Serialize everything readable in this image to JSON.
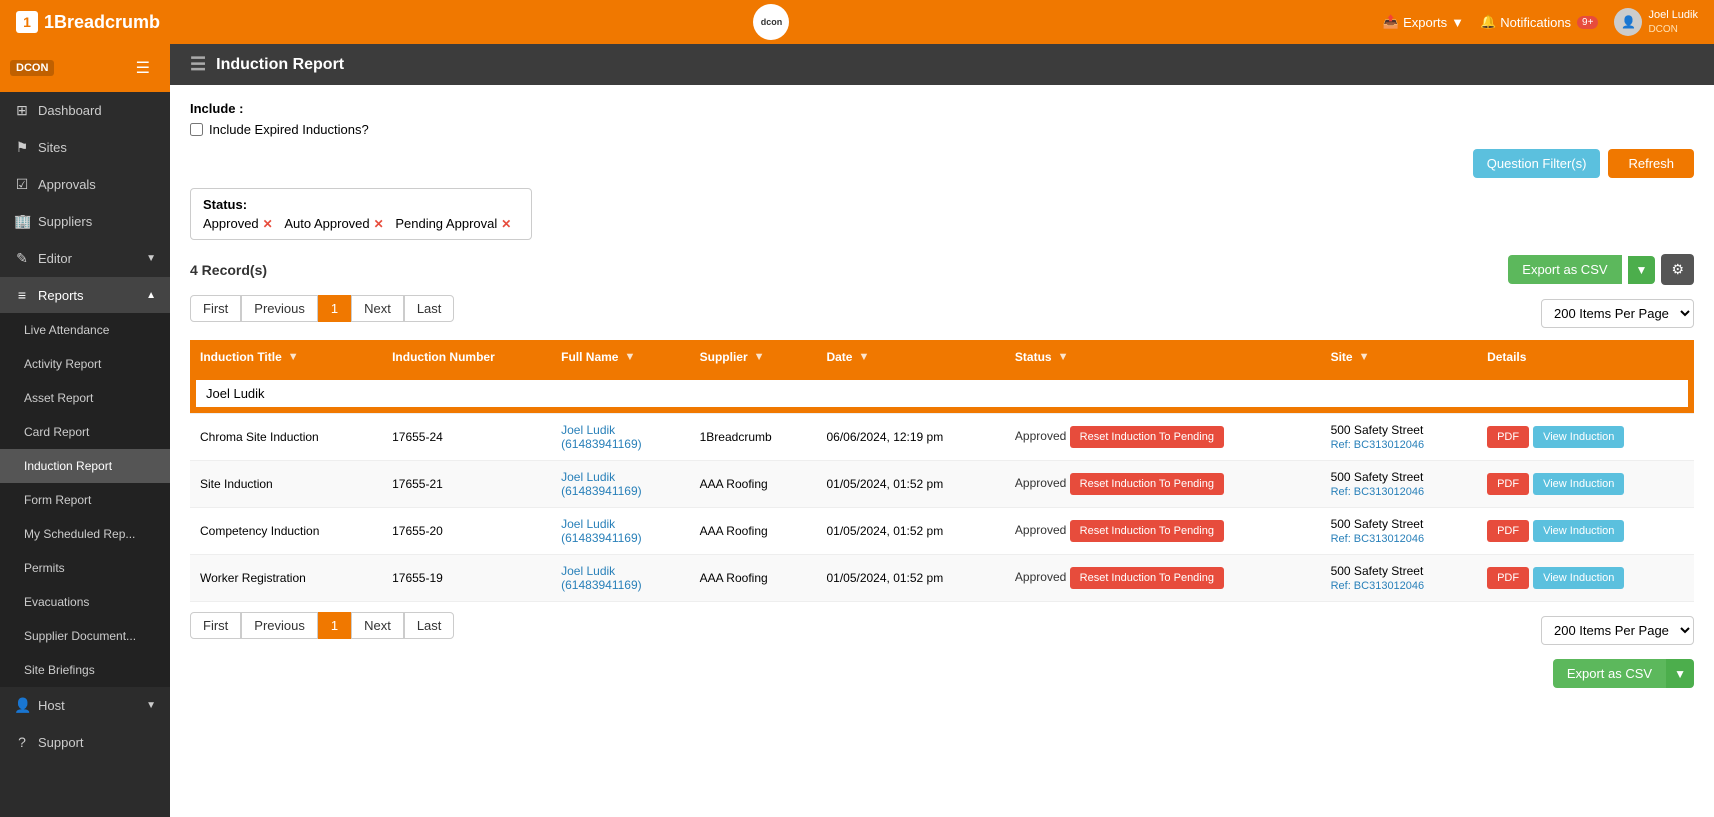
{
  "topNav": {
    "brandName": "1Breadcrumb",
    "logoText": "dcon",
    "exports": "Exports",
    "notifications": "Notifications",
    "notifCount": "9+",
    "userName": "Joel Ludik",
    "userTenant": "DCON"
  },
  "sidebar": {
    "tenant": "DCON",
    "items": [
      {
        "label": "Dashboard",
        "icon": "⊞",
        "id": "dashboard"
      },
      {
        "label": "Sites",
        "icon": "⚑",
        "id": "sites"
      },
      {
        "label": "Approvals",
        "icon": "☑",
        "id": "approvals"
      },
      {
        "label": "Suppliers",
        "icon": "🏢",
        "id": "suppliers"
      },
      {
        "label": "Editor",
        "icon": "✎",
        "id": "editor",
        "hasArrow": true
      },
      {
        "label": "Reports",
        "icon": "≡",
        "id": "reports",
        "expanded": true,
        "hasArrow": true
      },
      {
        "label": "Live Attendance",
        "id": "live-attendance",
        "sub": true
      },
      {
        "label": "Activity Report",
        "id": "activity-report",
        "sub": true
      },
      {
        "label": "Asset Report",
        "id": "asset-report",
        "sub": true
      },
      {
        "label": "Card Report",
        "id": "card-report",
        "sub": true
      },
      {
        "label": "Induction Report",
        "id": "induction-report",
        "sub": true,
        "active": true
      },
      {
        "label": "Form Report",
        "id": "form-report",
        "sub": true
      },
      {
        "label": "My Scheduled Rep...",
        "id": "my-scheduled-rep",
        "sub": true
      },
      {
        "label": "Permits",
        "id": "permits",
        "sub": true
      },
      {
        "label": "Evacuations",
        "id": "evacuations",
        "sub": true
      },
      {
        "label": "Supplier Document...",
        "id": "supplier-documents",
        "sub": true
      },
      {
        "label": "Site Briefings",
        "id": "site-briefings",
        "sub": true
      },
      {
        "label": "Host",
        "icon": "👤",
        "id": "host",
        "hasArrow": true
      },
      {
        "label": "Support",
        "icon": "?",
        "id": "support"
      }
    ]
  },
  "pageTitle": "Induction Report",
  "include": {
    "label": "Include :",
    "checkboxLabel": "Include Expired Inductions?",
    "checked": false
  },
  "filters": {
    "questionFilterBtn": "Question Filter(s)",
    "refreshBtn": "Refresh",
    "statusBox": {
      "title": "Status:",
      "tags": [
        "Approved",
        "Auto Approved",
        "Pending Approval"
      ]
    }
  },
  "table": {
    "recordCount": "4 Record(s)",
    "exportBtn": "Export as CSV",
    "settingsIcon": "⚙",
    "perPageLabel": "200 Items Per Page",
    "pagination": {
      "first": "First",
      "previous": "Previous",
      "page1": "1",
      "next": "Next",
      "last": "Last"
    },
    "columns": [
      "Induction Title",
      "Induction Number",
      "Full Name",
      "Supplier",
      "Date",
      "Status",
      "Site",
      "Details"
    ],
    "searchValue": "Joel Ludik",
    "rows": [
      {
        "inductionTitle": "Chroma Site Induction",
        "inductionNumber": "17655-24",
        "fullName": "Joel Ludik",
        "fullNameSub": "(61483941169)",
        "supplier": "1Breadcrumb",
        "date": "06/06/2024, 12:19 pm",
        "status": "Approved",
        "resetBtn": "Reset Induction To Pending",
        "site": "500 Safety Street",
        "siteRef": "Ref: BC313012046",
        "pdfBtn": "PDF",
        "viewBtn": "View Induction"
      },
      {
        "inductionTitle": "Site Induction",
        "inductionNumber": "17655-21",
        "fullName": "Joel Ludik",
        "fullNameSub": "(61483941169)",
        "supplier": "AAA Roofing",
        "date": "01/05/2024, 01:52 pm",
        "status": "Approved",
        "resetBtn": "Reset Induction To Pending",
        "site": "500 Safety Street",
        "siteRef": "Ref: BC313012046",
        "pdfBtn": "PDF",
        "viewBtn": "View Induction"
      },
      {
        "inductionTitle": "Competency Induction",
        "inductionNumber": "17655-20",
        "fullName": "Joel Ludik",
        "fullNameSub": "(61483941169)",
        "supplier": "AAA Roofing",
        "date": "01/05/2024, 01:52 pm",
        "status": "Approved",
        "resetBtn": "Reset Induction To Pending",
        "site": "500 Safety Street",
        "siteRef": "Ref: BC313012046",
        "pdfBtn": "PDF",
        "viewBtn": "View Induction"
      },
      {
        "inductionTitle": "Worker Registration",
        "inductionNumber": "17655-19",
        "fullName": "Joel Ludik",
        "fullNameSub": "(61483941169)",
        "supplier": "AAA Roofing",
        "date": "01/05/2024, 01:52 pm",
        "status": "Approved",
        "resetBtn": "Reset Induction To Pending",
        "site": "500 Safety Street",
        "siteRef": "Ref: BC313012046",
        "pdfBtn": "PDF",
        "viewBtn": "View Induction"
      }
    ]
  }
}
